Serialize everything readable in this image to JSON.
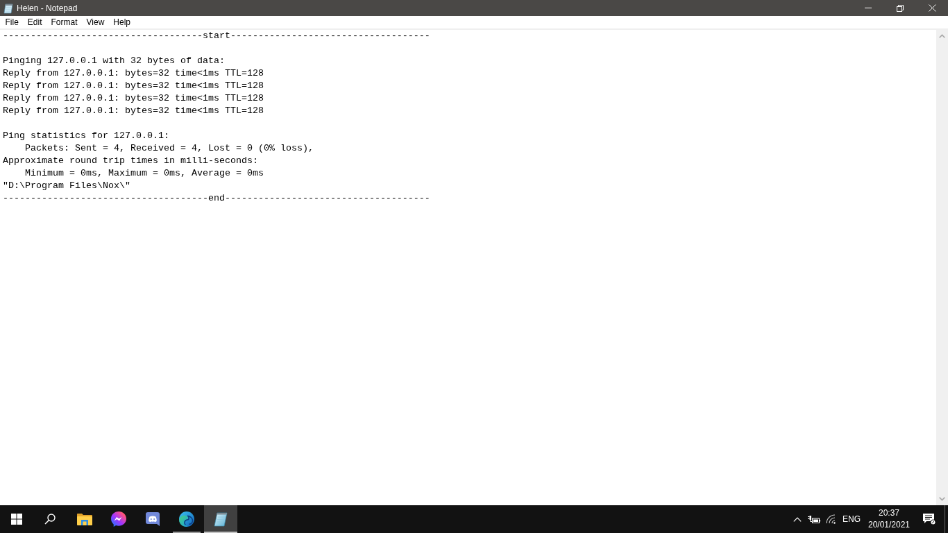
{
  "window": {
    "title": "Helen - Notepad"
  },
  "menu_bar": [
    "File",
    "Edit",
    "Format",
    "View",
    "Help"
  ],
  "editor": {
    "blocks": [
      [
        "------------------------------------start------------------------------------"
      ],
      [
        "Pinging 127.0.0.1 with 32 bytes of data:",
        "Reply from 127.0.0.1: bytes=32 time<1ms TTL=128",
        "Reply from 127.0.0.1: bytes=32 time<1ms TTL=128",
        "Reply from 127.0.0.1: bytes=32 time<1ms TTL=128",
        "Reply from 127.0.0.1: bytes=32 time<1ms TTL=128"
      ],
      [
        "Ping statistics for 127.0.0.1:",
        "    Packets: Sent = 4, Received = 4, Lost = 0 (0% loss),",
        "Approximate round trip times in milli-seconds:",
        "    Minimum = 0ms, Maximum = 0ms, Average = 0ms",
        "\"D:\\Program Files\\Nox\\\"",
        "-------------------------------------end-------------------------------------"
      ]
    ]
  },
  "taskbar": {
    "apps": [
      {
        "kind": "folder",
        "selected": false,
        "running": false
      },
      {
        "kind": "messenger",
        "selected": false,
        "running": false
      },
      {
        "kind": "gamepad-chat",
        "selected": false,
        "running": false
      },
      {
        "kind": "browser",
        "selected": false,
        "running": true
      },
      {
        "kind": "notepad",
        "selected": true,
        "running": true
      }
    ],
    "tray": {
      "language": "ENG",
      "time": "20:37",
      "date": "20/01/2021"
    }
  }
}
